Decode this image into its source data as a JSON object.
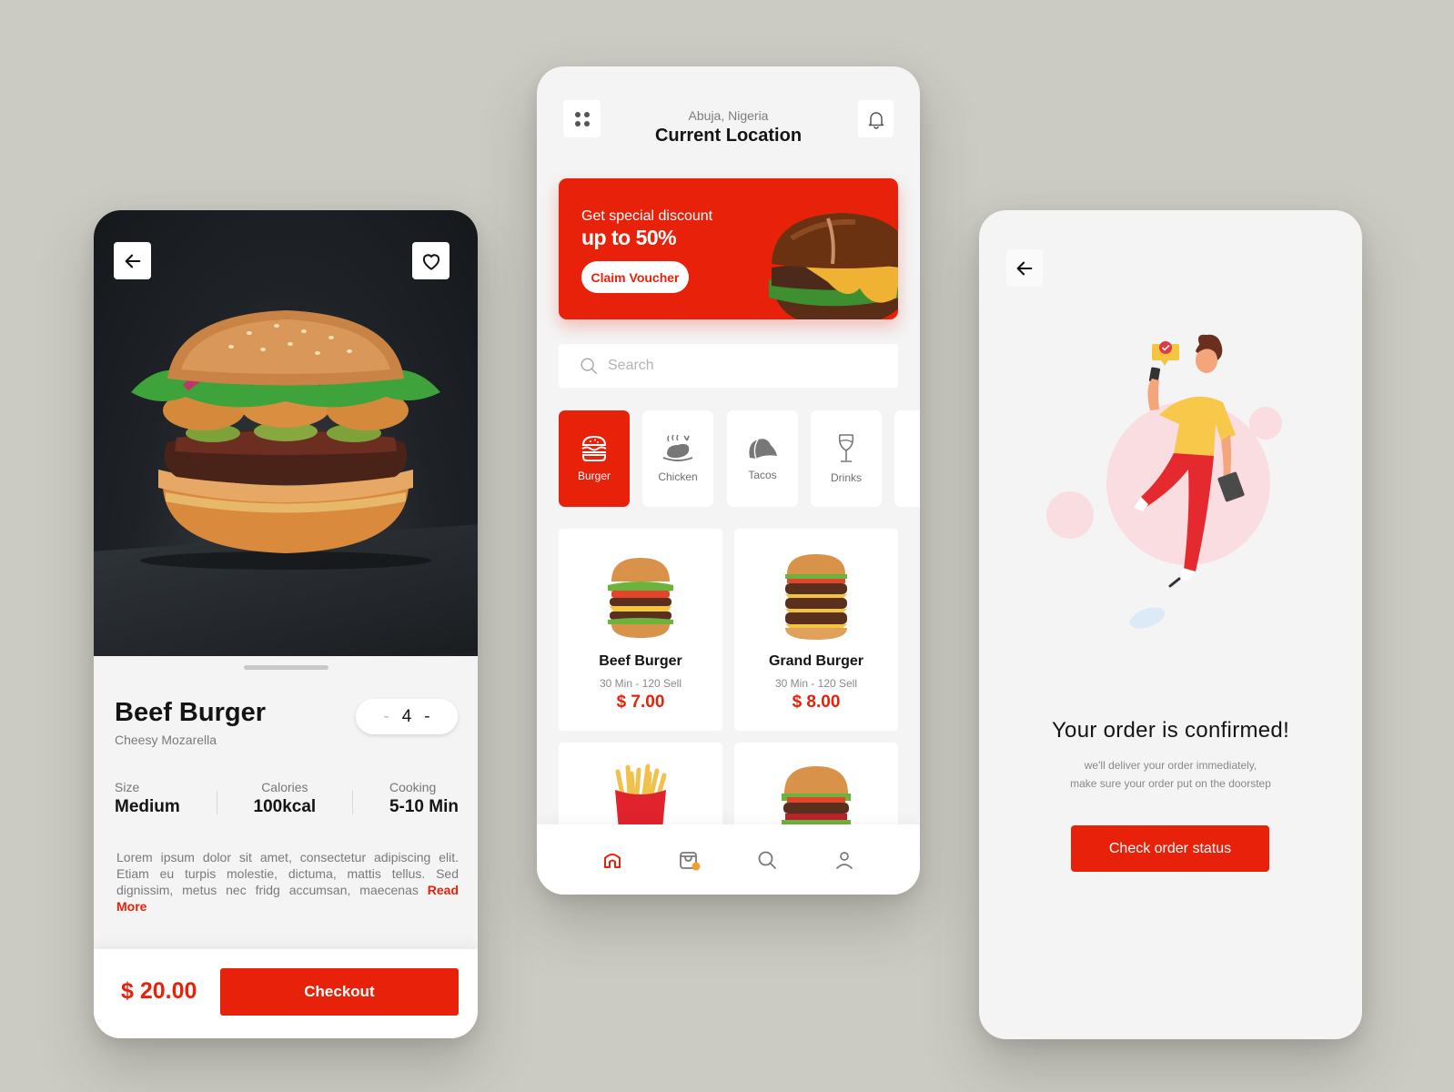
{
  "colors": {
    "accent": "#e8210a",
    "background": "#cbcac3",
    "card": "#f4f4f4"
  },
  "detail": {
    "back_icon": "arrow-left-icon",
    "favorite_icon": "heart-icon",
    "product_name": "Beef Burger",
    "product_subtitle": "Cheesy Mozarella",
    "quantity": {
      "value": "4",
      "minus": "-",
      "plus": "-"
    },
    "stats": [
      {
        "label": "Size",
        "value": "Medium"
      },
      {
        "label": "Calories",
        "value": "100kcal"
      },
      {
        "label": "Cooking",
        "value": "5-10 Min"
      }
    ],
    "description": "Lorem ipsum dolor sit amet, consectetur adipiscing elit. Etiam eu turpis molestie, dictuma, mattis tellus. Sed dignissim, metus nec fridg accumsan, maecenas",
    "read_more": "Read More",
    "total": "$ 20.00",
    "checkout_label": "Checkout"
  },
  "home": {
    "menu_icon": "grid-icon",
    "notification_icon": "bell-icon",
    "location_sub": "Abuja, Nigeria",
    "location_title": "Current Location",
    "promo": {
      "line1": "Get special discount",
      "line2": "up to 50%",
      "button": "Claim Voucher"
    },
    "search": {
      "placeholder": "Search",
      "value": ""
    },
    "categories": [
      {
        "label": "Burger",
        "icon": "burger-icon",
        "active": true
      },
      {
        "label": "Chicken",
        "icon": "roast-chicken-icon",
        "active": false
      },
      {
        "label": "Tacos",
        "icon": "taco-icon",
        "active": false
      },
      {
        "label": "Drinks",
        "icon": "wine-glass-icon",
        "active": false
      }
    ],
    "products": [
      {
        "name": "Beef Burger",
        "meta": "30 Min - 120 Sell",
        "price": "$ 7.00"
      },
      {
        "name": "Grand Burger",
        "meta": "30 Min - 120 Sell",
        "price": "$ 8.00"
      },
      {
        "name": "",
        "meta": "",
        "price": "",
        "image": "fries"
      },
      {
        "name": "",
        "meta": "",
        "price": "",
        "image": "burger"
      }
    ],
    "nav": [
      {
        "name": "home",
        "icon": "home-icon",
        "active": true
      },
      {
        "name": "orders",
        "icon": "shopping-bag-icon",
        "active": false,
        "badge": true
      },
      {
        "name": "search",
        "icon": "search-icon",
        "active": false
      },
      {
        "name": "profile",
        "icon": "user-icon",
        "active": false
      }
    ]
  },
  "confirm": {
    "back_icon": "arrow-left-icon",
    "title": "Your order is confirmed!",
    "subtitle_line1": "we'll deliver your order immediately,",
    "subtitle_line2": "make sure your order put on the doorstep",
    "button": "Check order status"
  }
}
